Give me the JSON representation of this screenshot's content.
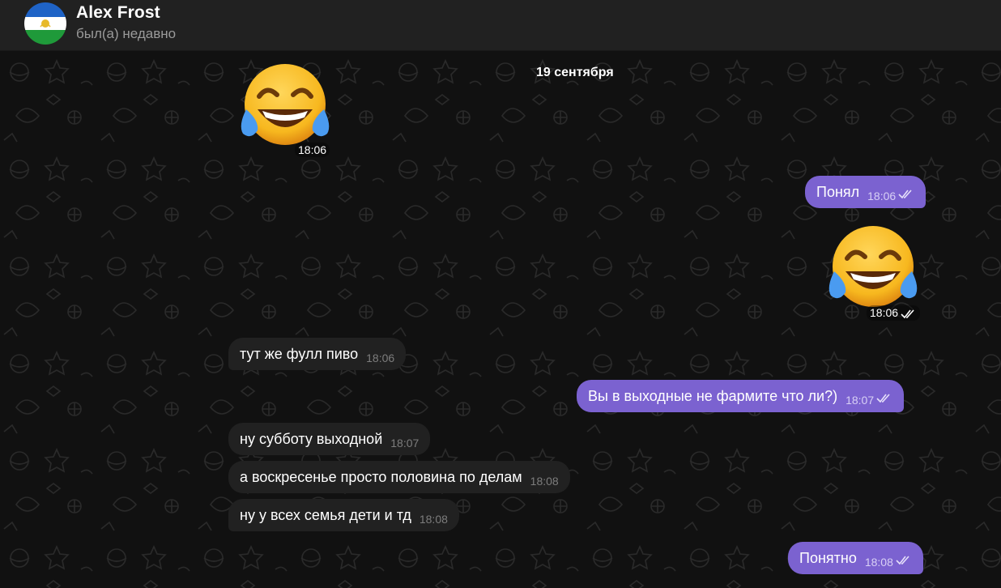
{
  "header": {
    "name": "Alex Frost",
    "status": "был(а) недавно"
  },
  "date_separator": "19 сентября",
  "messages": [
    {
      "direction": "in",
      "kind": "emoji",
      "emoji": "face-with-tears-of-joy",
      "time": "18:06"
    },
    {
      "direction": "out",
      "kind": "text",
      "text": "Понял",
      "time": "18:06",
      "read": true
    },
    {
      "direction": "out",
      "kind": "emoji",
      "emoji": "face-with-tears-of-joy",
      "time": "18:06",
      "read": true
    },
    {
      "direction": "in",
      "kind": "text",
      "text": "тут же фулл пиво",
      "time": "18:06"
    },
    {
      "direction": "out",
      "kind": "text",
      "text": "Вы в выходные не фармите что ли?)",
      "time": "18:07",
      "read": true
    },
    {
      "direction": "in",
      "kind": "text",
      "text": "ну субботу выходной",
      "time": "18:07"
    },
    {
      "direction": "in",
      "kind": "text",
      "text": "а воскресенье просто половина по делам",
      "time": "18:08"
    },
    {
      "direction": "in",
      "kind": "text",
      "text": "ну у всех семья дети и тд",
      "time": "18:08"
    },
    {
      "direction": "out",
      "kind": "text",
      "text": "Понятно",
      "time": "18:08",
      "read": true
    }
  ],
  "colors": {
    "outgoing_bubble": "#7b62d0",
    "incoming_bubble": "#212121",
    "header_bg": "#212121",
    "chat_bg": "#111111"
  },
  "icons": [
    "avatar-flag",
    "double-check-icon",
    "face-with-tears-of-joy-emoji"
  ]
}
